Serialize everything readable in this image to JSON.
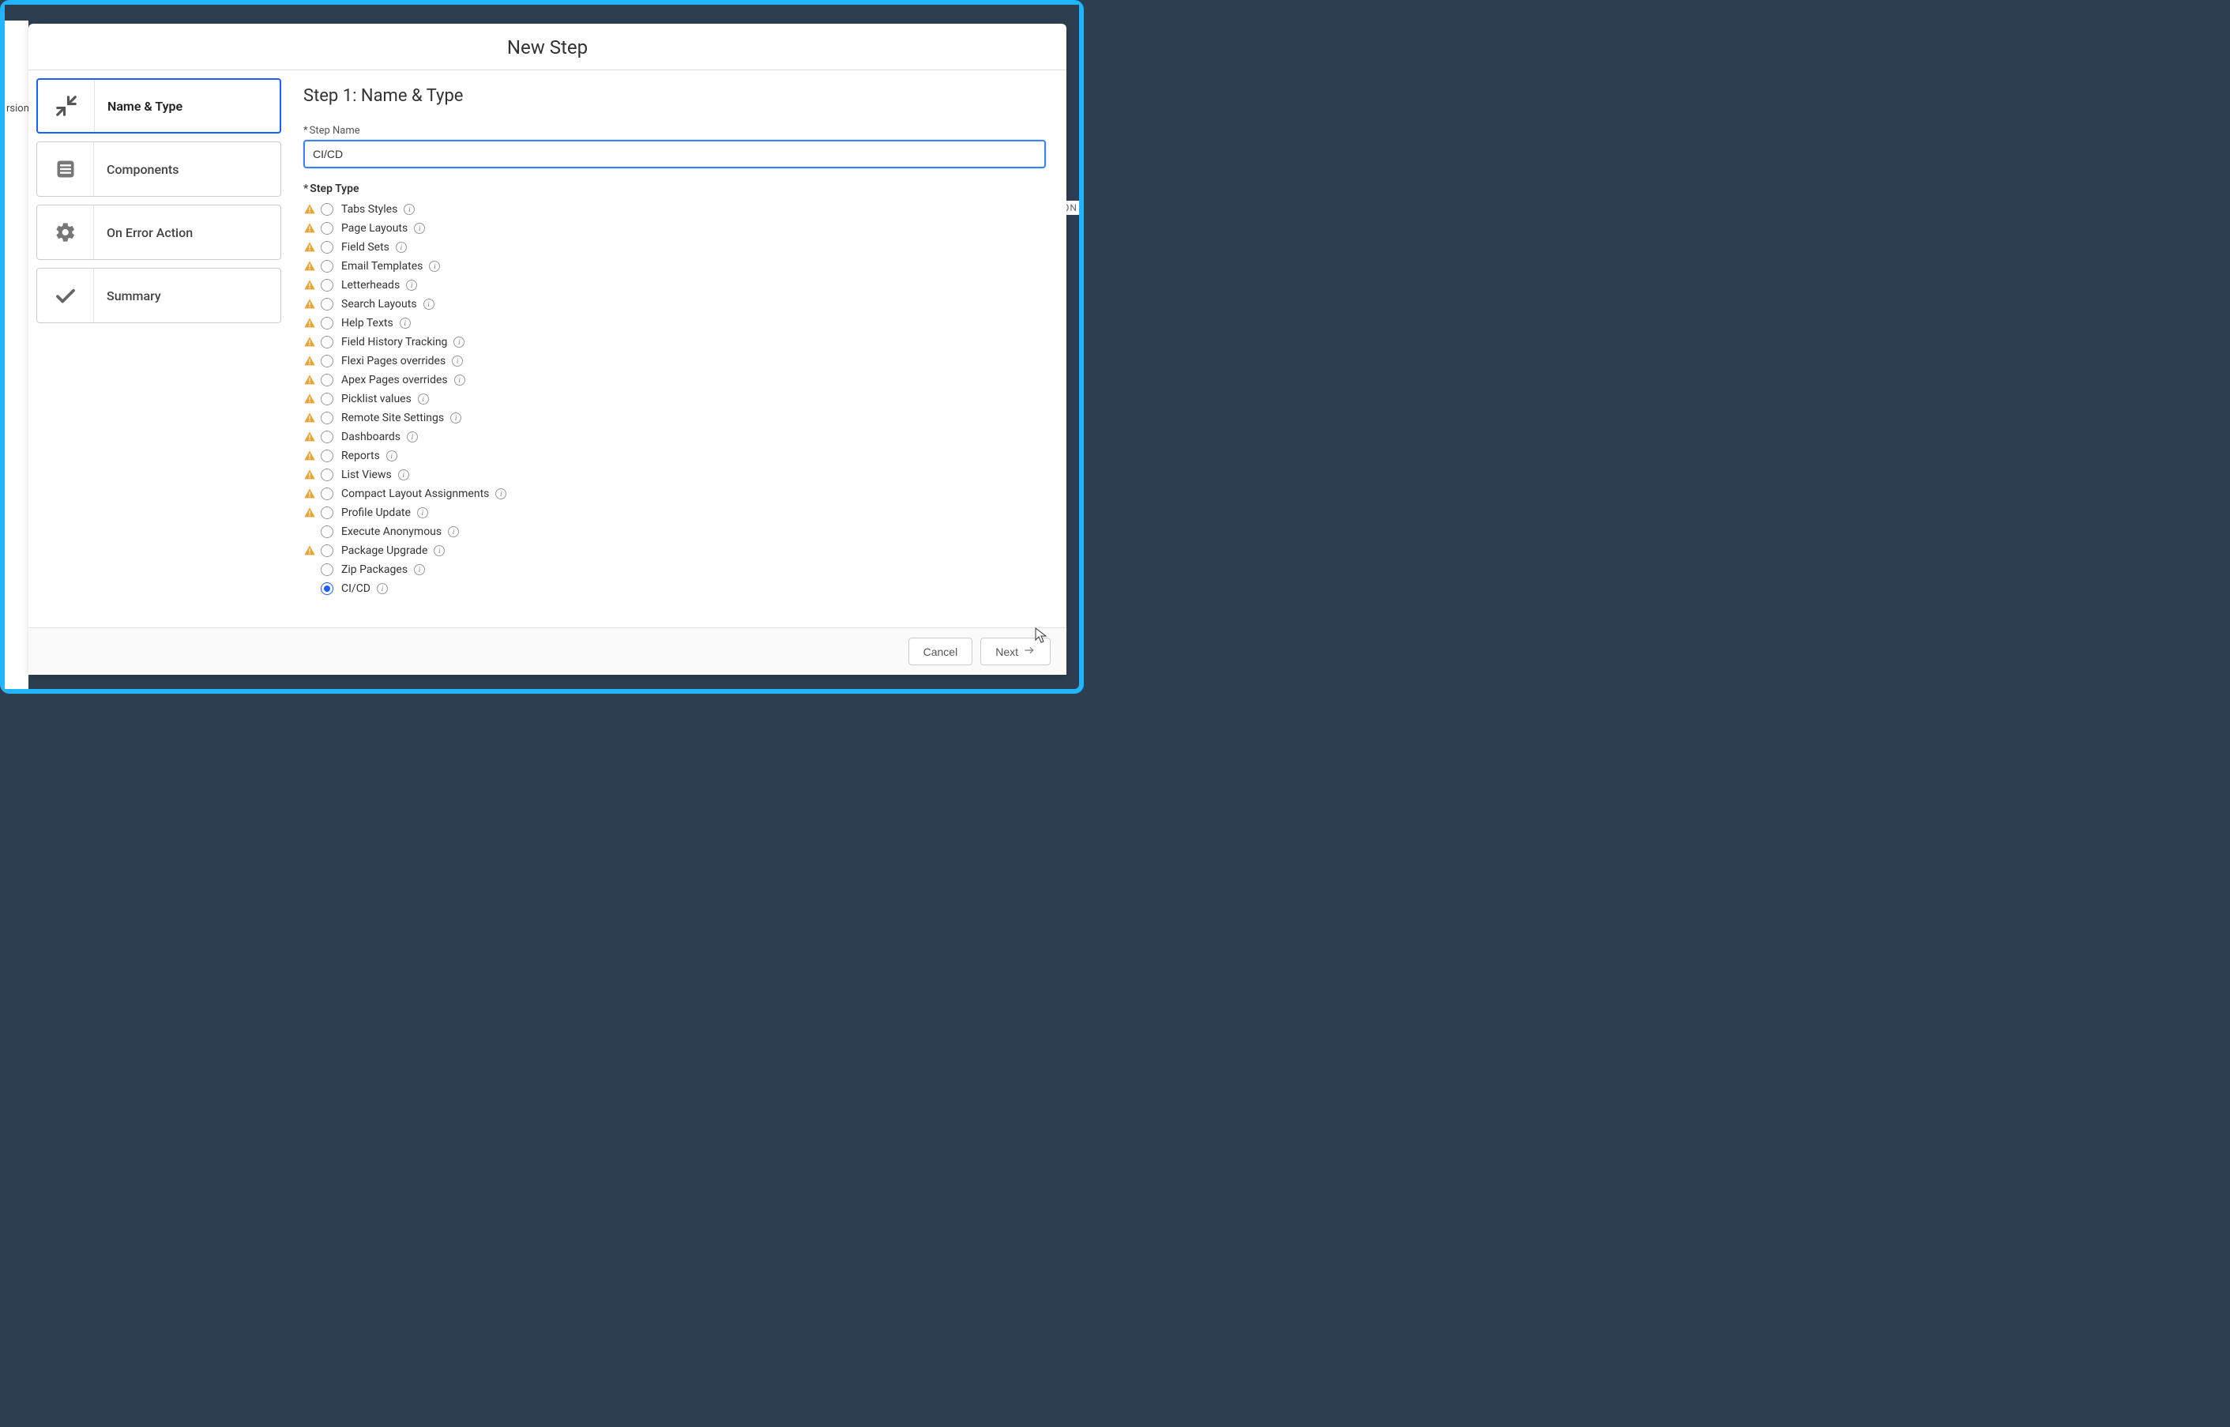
{
  "modal": {
    "title": "New Step"
  },
  "sidebar": {
    "steps": [
      {
        "label": "Name & Type",
        "active": true
      },
      {
        "label": "Components",
        "active": false
      },
      {
        "label": "On Error Action",
        "active": false
      },
      {
        "label": "Summary",
        "active": false
      }
    ]
  },
  "content": {
    "heading": "Step 1: Name & Type",
    "step_name_label": "Step Name",
    "step_name_value": "CI/CD ",
    "step_type_label": "Step Type",
    "types": [
      {
        "label": "Tabs Styles",
        "warn": true,
        "selected": false
      },
      {
        "label": "Page Layouts",
        "warn": true,
        "selected": false
      },
      {
        "label": "Field Sets",
        "warn": true,
        "selected": false
      },
      {
        "label": "Email Templates",
        "warn": true,
        "selected": false
      },
      {
        "label": "Letterheads",
        "warn": true,
        "selected": false
      },
      {
        "label": "Search Layouts",
        "warn": true,
        "selected": false
      },
      {
        "label": "Help Texts",
        "warn": true,
        "selected": false
      },
      {
        "label": "Field History Tracking",
        "warn": true,
        "selected": false
      },
      {
        "label": "Flexi Pages overrides",
        "warn": true,
        "selected": false
      },
      {
        "label": "Apex Pages overrides",
        "warn": true,
        "selected": false
      },
      {
        "label": "Picklist values",
        "warn": true,
        "selected": false
      },
      {
        "label": "Remote Site Settings",
        "warn": true,
        "selected": false
      },
      {
        "label": "Dashboards",
        "warn": true,
        "selected": false
      },
      {
        "label": "Reports",
        "warn": true,
        "selected": false
      },
      {
        "label": "List Views",
        "warn": true,
        "selected": false
      },
      {
        "label": "Compact Layout Assignments",
        "warn": true,
        "selected": false
      },
      {
        "label": "Profile Update",
        "warn": true,
        "selected": false
      },
      {
        "label": "Execute Anonymous",
        "warn": false,
        "selected": false
      },
      {
        "label": "Package Upgrade",
        "warn": true,
        "selected": false
      },
      {
        "label": "Zip Packages",
        "warn": false,
        "selected": false
      },
      {
        "label": "CI/CD",
        "warn": false,
        "selected": true
      }
    ]
  },
  "footer": {
    "cancel": "Cancel",
    "next": "Next"
  },
  "bg": {
    "left_text": "rsion",
    "right_text": "ON"
  }
}
